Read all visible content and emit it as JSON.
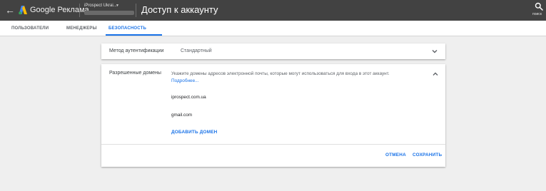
{
  "topbar": {
    "brand": "Google Реклама",
    "account_name": "iProspect Ukrai...",
    "page_title": "Доступ к аккаунту",
    "search_label": "поиск",
    "icons": {
      "back": "back-arrow-icon",
      "logo": "google-ads-logo",
      "search": "search-icon"
    }
  },
  "tabs": [
    {
      "label": "ПОЛЬЗОВАТЕЛИ",
      "active": false
    },
    {
      "label": "МЕНЕДЖЕРЫ",
      "active": false
    },
    {
      "label": "БЕЗОПАСНОСТЬ",
      "active": true
    }
  ],
  "auth": {
    "label": "Метод аутентификации",
    "value": "Стандартный"
  },
  "domains": {
    "label": "Разрешенные домены",
    "description": "Укажите домены адресов электронной почты, которые могут использоваться для входа в этот аккаунт.",
    "more_link": "Подробнее...",
    "items": [
      "iprospect.com.ua",
      "gmail.com"
    ],
    "add_label": "ДОБАВИТЬ ДОМЕН",
    "cancel_label": "ОТМЕНА",
    "save_label": "СОХРАНИТЬ"
  },
  "colors": {
    "topbar": "#424242",
    "accent": "#1a73e8",
    "background": "#efefef"
  }
}
